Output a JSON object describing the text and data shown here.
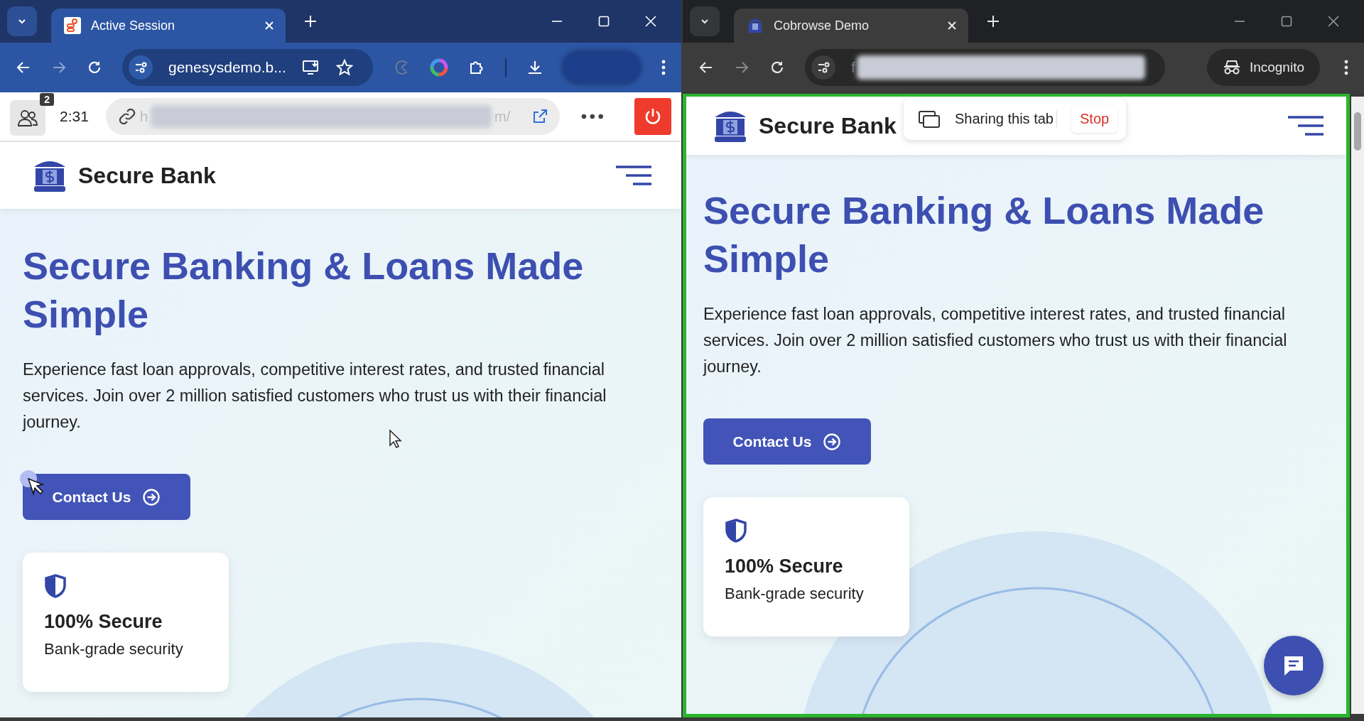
{
  "windows": [
    {
      "kind": "agent",
      "tab": {
        "title": "Active Session"
      },
      "address": "genesysdemo.b...",
      "cobrowse_bar": {
        "participants": "2",
        "timer": "2:31",
        "url_start": "h",
        "url_end": "m/"
      },
      "site": {
        "brand": "Secure Bank",
        "heading": "Secure Banking & Loans Made Simple",
        "paragraph": "Experience fast loan approvals, competitive interest rates, and trusted financial services. Join over 2 million satisfied customers who trust us with their financial journey.",
        "cta": "Contact Us",
        "feature": {
          "title": "100% Secure",
          "text": "Bank-grade security"
        }
      }
    },
    {
      "kind": "customer",
      "tab": {
        "title": "Cobrowse Demo"
      },
      "address_start": "f",
      "incognito": "Incognito",
      "sharing": {
        "message": "Sharing this tab",
        "stop": "Stop"
      },
      "site": {
        "brand": "Secure Bank",
        "heading": "Secure Banking & Loans Made Simple",
        "paragraph": "Experience fast loan approvals, competitive interest rates, and trusted financial services. Join over 2 million satisfied customers who trust us with their financial journey.",
        "cta": "Contact Us",
        "feature": {
          "title": "100% Secure",
          "text": "Bank-grade security"
        }
      }
    }
  ]
}
